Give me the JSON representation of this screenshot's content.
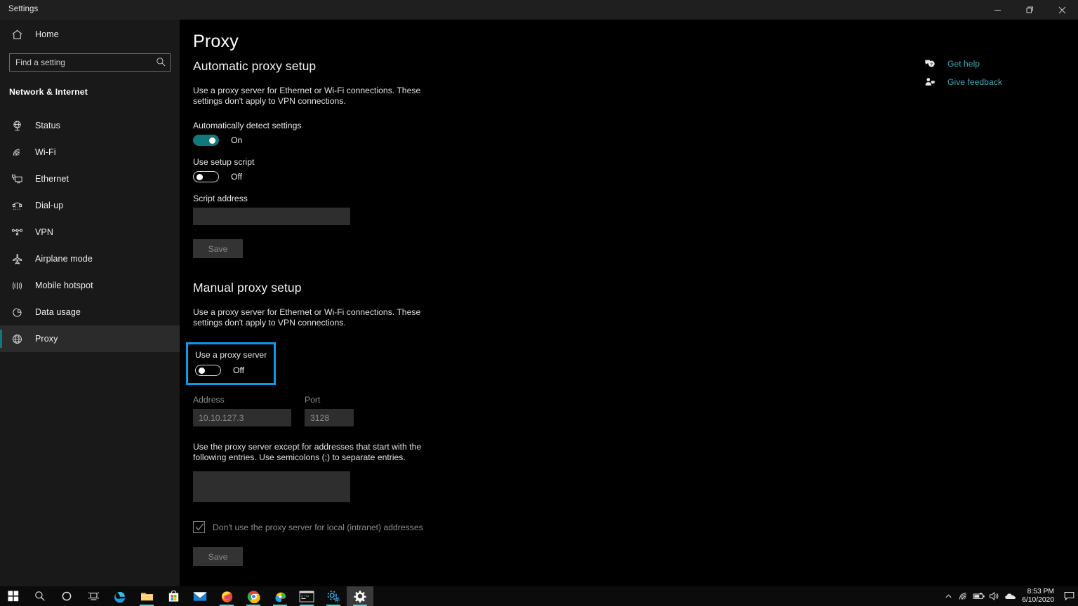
{
  "window": {
    "title": "Settings",
    "controls": {
      "minimize": "minimize-button",
      "restore": "restore-button",
      "close": "close-button"
    }
  },
  "sidebar": {
    "home_label": "Home",
    "search": {
      "placeholder": "Find a setting",
      "value": ""
    },
    "category": "Network & Internet",
    "items": [
      {
        "label": "Status",
        "icon": "globe-status-icon",
        "selected": false
      },
      {
        "label": "Wi-Fi",
        "icon": "wifi-icon",
        "selected": false
      },
      {
        "label": "Ethernet",
        "icon": "ethernet-icon",
        "selected": false
      },
      {
        "label": "Dial-up",
        "icon": "dialup-icon",
        "selected": false
      },
      {
        "label": "VPN",
        "icon": "vpn-icon",
        "selected": false
      },
      {
        "label": "Airplane mode",
        "icon": "airplane-icon",
        "selected": false
      },
      {
        "label": "Mobile hotspot",
        "icon": "hotspot-icon",
        "selected": false
      },
      {
        "label": "Data usage",
        "icon": "data-usage-icon",
        "selected": false
      },
      {
        "label": "Proxy",
        "icon": "proxy-globe-icon",
        "selected": true
      }
    ]
  },
  "page": {
    "title": "Proxy",
    "automatic": {
      "heading": "Automatic proxy setup",
      "description": "Use a proxy server for Ethernet or Wi-Fi connections. These settings don't apply to VPN connections.",
      "auto_detect_label": "Automatically detect settings",
      "auto_detect_state": "On",
      "setup_script_label": "Use setup script",
      "setup_script_state": "Off",
      "script_address_label": "Script address",
      "script_address_value": "",
      "save_label": "Save"
    },
    "manual": {
      "heading": "Manual proxy setup",
      "description": "Use a proxy server for Ethernet or Wi-Fi connections. These settings don't apply to VPN connections.",
      "use_proxy_label": "Use a proxy server",
      "use_proxy_state": "Off",
      "address_label": "Address",
      "address_value": "10.10.127.3",
      "port_label": "Port",
      "port_value": "3128",
      "exceptions_description": "Use the proxy server except for addresses that start with the following entries. Use semicolons (;) to separate entries.",
      "exceptions_value": "",
      "bypass_local_label": "Don't use the proxy server for local (intranet) addresses",
      "bypass_local_checked": true,
      "save_label": "Save"
    }
  },
  "help": {
    "items": [
      {
        "label": "Get help",
        "icon": "question-bubble-icon"
      },
      {
        "label": "Give feedback",
        "icon": "feedback-person-icon"
      }
    ]
  },
  "taskbar": {
    "items": [
      {
        "name": "start-button",
        "icon": "windows-logo-icon",
        "running": false
      },
      {
        "name": "search-button",
        "icon": "search-icon",
        "running": false
      },
      {
        "name": "cortana-button",
        "icon": "cortana-circle-icon",
        "running": false
      },
      {
        "name": "task-view-button",
        "icon": "task-view-icon",
        "running": false
      },
      {
        "name": "edge-button",
        "icon": "edge-icon",
        "running": false
      },
      {
        "name": "file-explorer-button",
        "icon": "folder-icon",
        "running": true
      },
      {
        "name": "microsoft-store-button",
        "icon": "store-bag-icon",
        "running": false
      },
      {
        "name": "mail-button",
        "icon": "envelope-icon",
        "running": false
      },
      {
        "name": "firefox-button",
        "icon": "firefox-icon",
        "running": true
      },
      {
        "name": "chrome-button",
        "icon": "chrome-icon",
        "running": true
      },
      {
        "name": "paint-button",
        "icon": "paint-palette-icon",
        "running": true
      },
      {
        "name": "command-prompt-button",
        "icon": "terminal-icon",
        "running": true
      },
      {
        "name": "settings-gear-blue-button",
        "icon": "gear-blue-icon",
        "running": true
      },
      {
        "name": "settings-active-button",
        "icon": "gear-icon",
        "running": true
      }
    ],
    "tray": {
      "chevron": "chevron-up-icon",
      "icons": [
        "wifi-tray-icon",
        "battery-icon",
        "volume-icon",
        "onedrive-cloud-icon"
      ],
      "time": "8:53 PM",
      "date": "6/10/2020",
      "notification": "action-center-icon"
    }
  },
  "colors": {
    "accent_teal": "#12787c",
    "highlight_blue": "#0a9bef",
    "link_teal": "#41a7b3",
    "input_bg": "#2e2e2e",
    "sidebar_bg": "#191919"
  }
}
